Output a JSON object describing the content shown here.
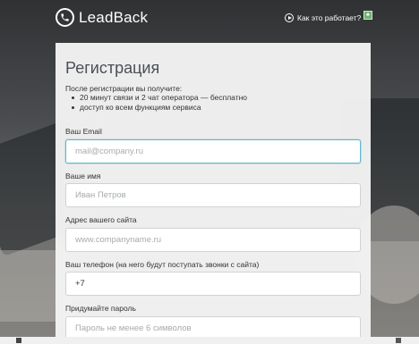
{
  "header": {
    "logo_text": "LeadBack",
    "logo_icon": "phone-icon",
    "how_link": "Как это работает?"
  },
  "form": {
    "title": "Регистрация",
    "intro": "После регистрации вы получите:",
    "benefits": [
      "20 минут связи и 2 чат оператора — бесплатно",
      "доступ ко всем функциям сервиса"
    ],
    "fields": {
      "email": {
        "label": "Ваш Email",
        "placeholder": "mail@company.ru"
      },
      "name": {
        "label": "Ваше имя",
        "placeholder": "Иван Петров"
      },
      "site": {
        "label": "Адрес вашего сайта",
        "placeholder": "www.companyname.ru"
      },
      "phone": {
        "label": "Ваш телефон (на него будут поступать звонки с сайта)",
        "value": "+7"
      },
      "password": {
        "label": "Придумайте пароль",
        "placeholder": "Пароль не менее 6 символов"
      }
    }
  },
  "colors": {
    "accent": "#5fb9c8",
    "panel": "#f3f3f3",
    "title": "#4b4f56"
  }
}
